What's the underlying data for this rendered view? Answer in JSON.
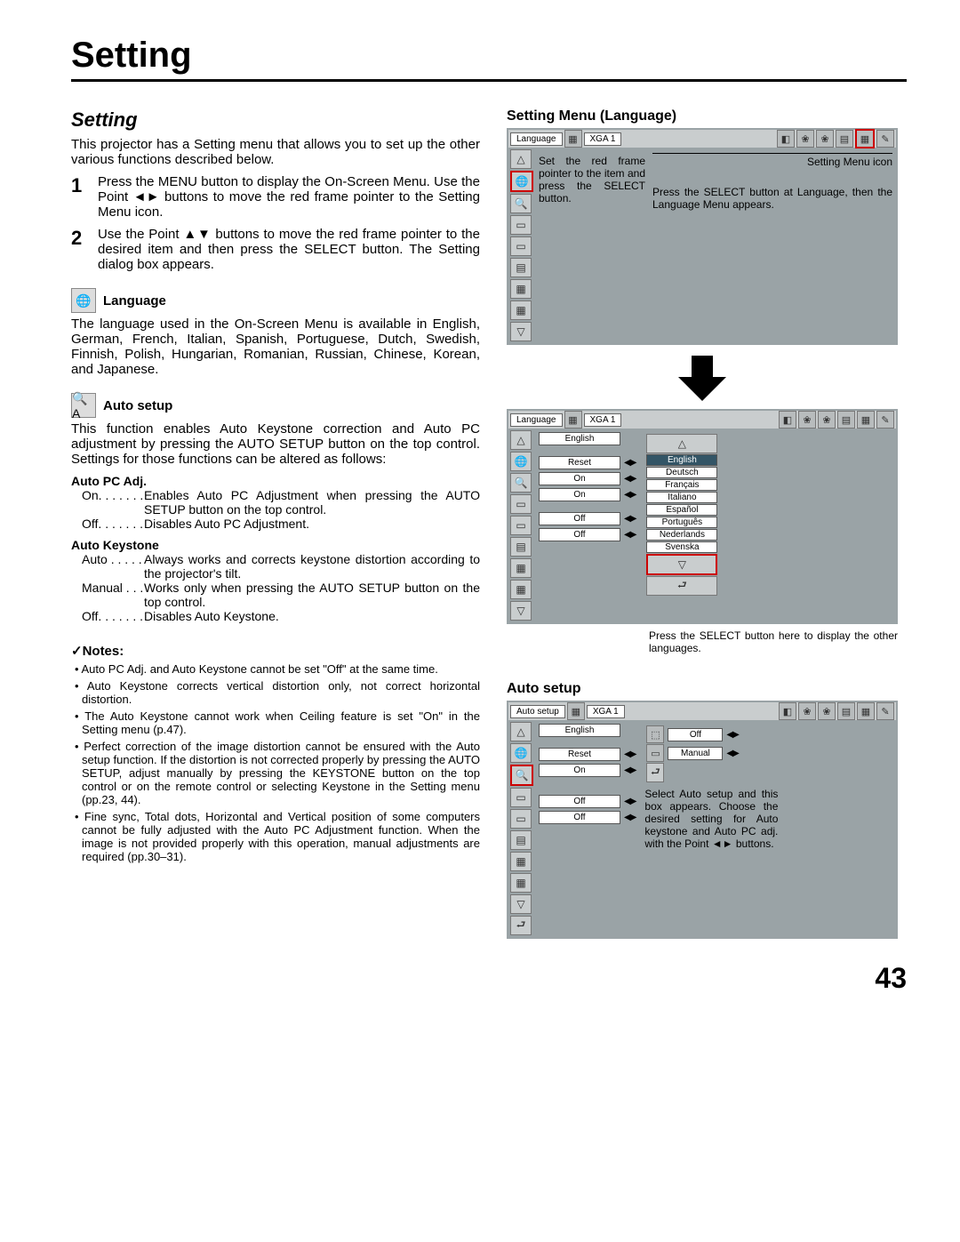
{
  "page": {
    "title": "Setting",
    "number": "43"
  },
  "left": {
    "heading": "Setting",
    "intro": "This projector has a Setting menu that allows you to set up the other various functions described below.",
    "step1_num": "1",
    "step1": "Press the MENU button to display the On-Screen Menu. Use the Point ◄► buttons to move the red frame pointer to the Setting Menu icon.",
    "step2_num": "2",
    "step2": "Use the Point ▲▼ buttons to move the red frame pointer to the desired item and then press the SELECT button. The Setting dialog box appears.",
    "language": {
      "label": "Language",
      "desc": "The language used in the On-Screen Menu is available in English, German, French, Italian, Spanish, Portuguese, Dutch, Swedish, Finnish, Polish, Hungarian, Romanian, Russian, Chinese, Korean, and Japanese."
    },
    "autosetup": {
      "label": "Auto setup",
      "desc": "This function enables Auto Keystone correction and Auto PC adjustment by pressing the AUTO SETUP button on the top control. Settings for those functions can be altered as follows:",
      "autopc_label": "Auto PC Adj.",
      "autopc_on_k": "On. . . . . . .",
      "autopc_on_v": "Enables Auto PC Adjustment when pressing the AUTO SETUP button on the top control.",
      "autopc_off_k": "Off. . . . . . .",
      "autopc_off_v": "Disables Auto PC Adjustment.",
      "autoks_label": "Auto Keystone",
      "autoks_auto_k": "Auto . . . . .",
      "autoks_auto_v": "Always works and corrects keystone distortion according to the projector's tilt.",
      "autoks_manual_k": "Manual . . .",
      "autoks_manual_v": "Works only when pressing the AUTO SETUP button on the top control.",
      "autoks_off_k": "Off. . . . . . .",
      "autoks_off_v": "Disables Auto Keystone."
    },
    "notes": {
      "head": "✓Notes:",
      "n1": "• Auto PC Adj. and Auto Keystone cannot be set \"Off\" at the same time.",
      "n2": "• Auto Keystone corrects vertical distortion only, not correct horizontal distortion.",
      "n3": "• The Auto Keystone cannot work when Ceiling feature is set \"On\" in the Setting menu (p.47).",
      "n4": "• Perfect correction of the image distortion cannot be ensured with the Auto setup function. If the distortion is not corrected properly by pressing the AUTO SETUP, adjust manually by pressing the KEYSTONE button on the top control or on the remote control or selecting Keystone in the Setting menu (pp.23, 44).",
      "n5": "• Fine sync, Total dots, Horizontal and Vertical position of some computers cannot be fully adjusted with the Auto PC Adjustment function. When the image is not provided properly with this operation, manual adjustments are required (pp.30–31)."
    }
  },
  "right": {
    "title1": "Setting Menu (Language)",
    "osd1_title": "Language",
    "osd1_src": "XGA 1",
    "callout1": "Set the red frame pointer to the item and press the SELECT button.",
    "callout1b": "Setting Menu icon",
    "callout2": "Press the SELECT button at Language, then the Language Menu appears.",
    "osd2_title": "Language",
    "osd2_src": "XGA 1",
    "osd2_vals": {
      "a": "English",
      "b": "Reset",
      "c": "On",
      "d": "On",
      "e": "Off",
      "f": "Off"
    },
    "langs": [
      "English",
      "Deutsch",
      "Français",
      "Italiano",
      "Español",
      "Português",
      "Nederlands",
      "Svenska"
    ],
    "callout3": "Press the SELECT button here to display the other languages.",
    "title2": "Auto setup",
    "osd3_title": "Auto setup",
    "osd3_src": "XGA 1",
    "osd3_vals": {
      "a": "English",
      "b": "Reset",
      "c": "On",
      "d": "Off",
      "e": "Off"
    },
    "osd3_box": {
      "a": "Off",
      "b": "Manual"
    },
    "callout4": "Select Auto setup and this box appears. Choose the desired setting for Auto keystone and Auto PC adj. with the Point ◄► buttons."
  }
}
